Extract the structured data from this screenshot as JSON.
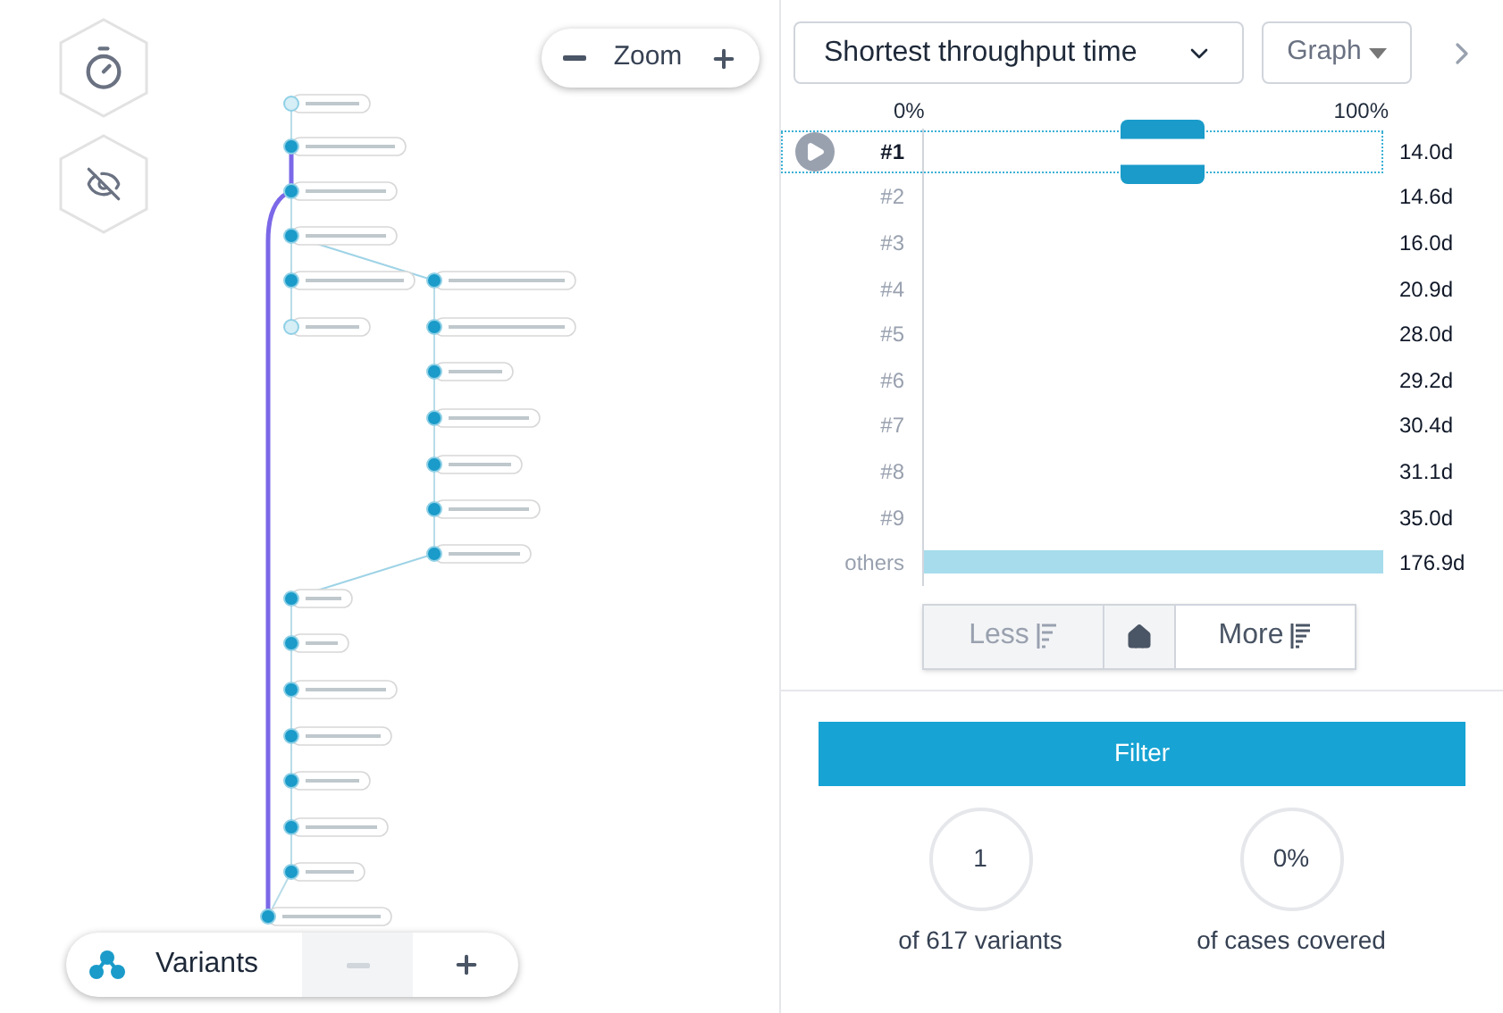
{
  "map_controls": {
    "zoom_label": "Zoom"
  },
  "variants_bar": {
    "label": "Variants",
    "remove_disabled": true
  },
  "sort_select": {
    "value": "Shortest throughput time"
  },
  "view_button": {
    "label": "Graph"
  },
  "axis": {
    "start": "0%",
    "end": "100%"
  },
  "variants": [
    {
      "label": "#1",
      "duration": "14.0d",
      "selected": true
    },
    {
      "label": "#2",
      "duration": "14.6d",
      "selected": false
    },
    {
      "label": "#3",
      "duration": "16.0d",
      "selected": false
    },
    {
      "label": "#4",
      "duration": "20.9d",
      "selected": false
    },
    {
      "label": "#5",
      "duration": "28.0d",
      "selected": false
    },
    {
      "label": "#6",
      "duration": "29.2d",
      "selected": false
    },
    {
      "label": "#7",
      "duration": "30.4d",
      "selected": false
    },
    {
      "label": "#8",
      "duration": "31.1d",
      "selected": false
    },
    {
      "label": "#9",
      "duration": "35.0d",
      "selected": false
    },
    {
      "label": "others",
      "duration": "176.9d",
      "selected": false,
      "level": 0.99
    }
  ],
  "paging": {
    "less": "Less",
    "less_disabled": true,
    "more": "More"
  },
  "filter_button": "Filter",
  "stats": [
    {
      "value": "1",
      "caption": "of 617 variants"
    },
    {
      "value": "0%",
      "caption": "of cases covered"
    }
  ]
}
